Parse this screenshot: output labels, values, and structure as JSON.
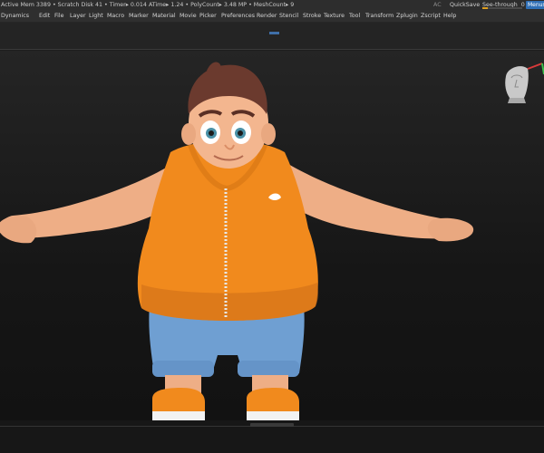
{
  "titlebar": {
    "stats": "Active Mem 3389 • Scratch Disk 41 • Timer▸ 0.014 ATime▸ 1.24 • PolyCount▸ 3.48 MP • MeshCount▸ 9",
    "ac_label": "AC",
    "quicksave_label": "QuickSave",
    "seethrough_label": "See-through",
    "seethrough_value": "0",
    "seethrough_level": 0,
    "menus_label": "Menus"
  },
  "menubar": {
    "items": [
      "Dynamics",
      "Edit",
      "File",
      "Layer",
      "Light",
      "Macro",
      "Marker",
      "Material",
      "Movie",
      "Picker",
      "Preferences",
      "Render",
      "Stencil",
      "Stroke",
      "Texture",
      "Tool",
      "Transform",
      "Zplugin",
      "Zscript",
      "Help"
    ]
  },
  "colors": {
    "accent": "#2f6fb5",
    "seethrough_fill": "#e0a020",
    "vest": "#f18a1d",
    "shorts": "#6f9fd2",
    "skin": "#f3b68f",
    "hair": "#6b3a2e"
  },
  "viewport": {
    "model": "cartoon-character-t-pose",
    "orientation_widget": "head-icon"
  }
}
